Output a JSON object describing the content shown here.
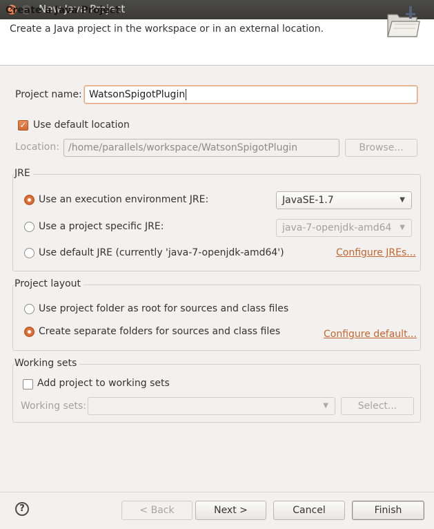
{
  "window": {
    "title": "New Java Project",
    "close_glyph": "✕",
    "minimize_glyph": "–"
  },
  "header": {
    "title": "Create a Java Project",
    "description": "Create a Java project in the workspace or in an external location."
  },
  "project": {
    "name_label": "Project name:",
    "name_value": "WatsonSpigotPlugin"
  },
  "location": {
    "use_default_label": "Use default location",
    "use_default_checked": true,
    "label": "Location:",
    "value": "/home/parallels/workspace/WatsonSpigotPlugin",
    "browse_label": "Browse..."
  },
  "jre": {
    "group_title": "JRE",
    "exec_env_label": "Use an execution environment JRE:",
    "exec_env_value": "JavaSE-1.7",
    "project_specific_label": "Use a project specific JRE:",
    "project_specific_value": "java-7-openjdk-amd64",
    "default_label": "Use default JRE (currently 'java-7-openjdk-amd64')",
    "configure_label": "Configure JREs...",
    "selected": "exec_env"
  },
  "layout": {
    "group_title": "Project layout",
    "root_label": "Use project folder as root for sources and class files",
    "separate_label": "Create separate folders for sources and class files",
    "configure_label": "Configure default...",
    "selected": "separate"
  },
  "working_sets": {
    "group_title": "Working sets",
    "add_label": "Add project to working sets",
    "add_checked": false,
    "sets_label": "Working sets:",
    "sets_value": "",
    "select_label": "Select..."
  },
  "footer": {
    "help_glyph": "?",
    "back_label": "< Back",
    "next_label": "Next >",
    "cancel_label": "Cancel",
    "finish_label": "Finish"
  },
  "icons": {
    "checkmark": "✓",
    "dropdown_arrow": "▼"
  },
  "colors": {
    "accent": "#dd6a32",
    "link": "#c4652d",
    "titlebar": "#3c3b37"
  }
}
